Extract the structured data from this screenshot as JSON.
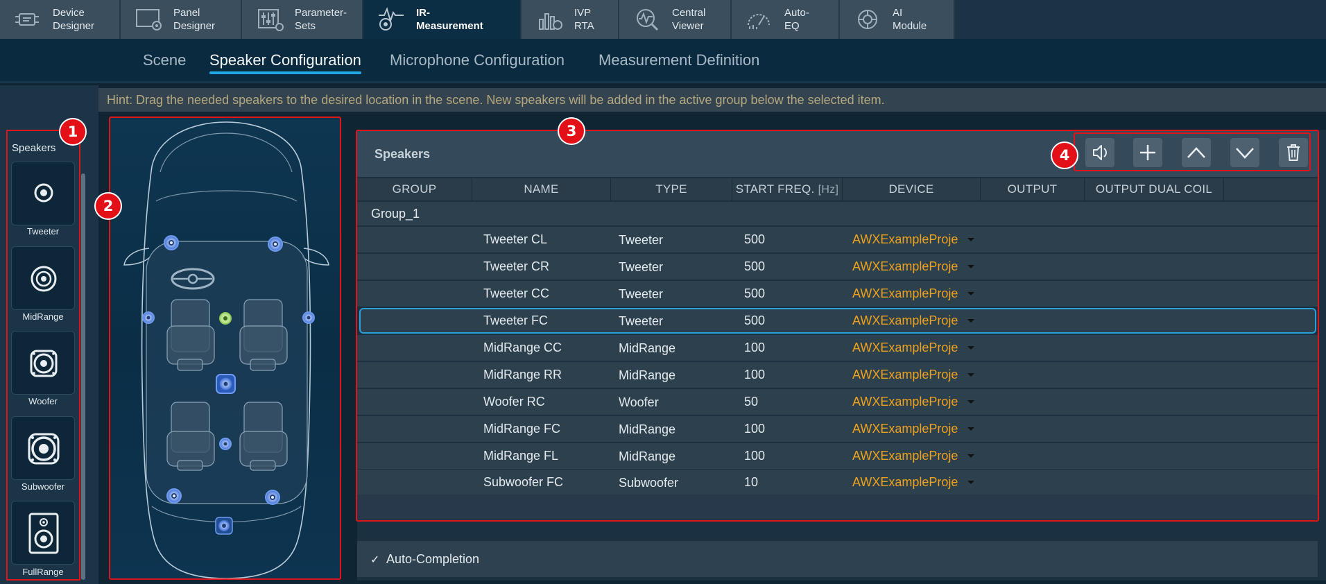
{
  "modules": [
    {
      "label": "Device\nDesigner",
      "icon": "device-designer-icon",
      "active": false
    },
    {
      "label": "Panel\nDesigner",
      "icon": "panel-designer-icon",
      "active": false
    },
    {
      "label": "Parameter-\nSets",
      "icon": "parameter-sets-icon",
      "active": false
    },
    {
      "label": "IR-\nMeasurement",
      "icon": "ir-measurement-icon",
      "active": true
    },
    {
      "label": "IVP\nRTA",
      "icon": "ivp-rta-icon",
      "active": false
    },
    {
      "label": "Central\nViewer",
      "icon": "central-viewer-icon",
      "active": false
    },
    {
      "label": "Auto-\nEQ",
      "icon": "auto-eq-icon",
      "active": false
    },
    {
      "label": "AI\nModule",
      "icon": "ai-module-icon",
      "active": false
    }
  ],
  "subtabs": [
    {
      "label": "Scene",
      "active": false
    },
    {
      "label": "Speaker Configuration",
      "active": true
    },
    {
      "label": "Microphone Configuration",
      "active": false
    },
    {
      "label": "Measurement Definition",
      "active": false
    }
  ],
  "hint": "Hint: Drag the needed speakers to the desired location in the scene. New speakers will be added in the active group below the selected item.",
  "palette": {
    "title": "Speakers",
    "items": [
      "Tweeter",
      "MidRange",
      "Woofer",
      "Subwoofer",
      "FullRange"
    ]
  },
  "badges": [
    "1",
    "2",
    "3",
    "4"
  ],
  "table": {
    "title": "Speakers",
    "toolbar_icons": [
      "speaker-test-icon",
      "add-icon",
      "move-up-icon",
      "move-down-icon",
      "delete-icon"
    ],
    "columns": {
      "group": "GROUP",
      "name": "NAME",
      "type": "TYPE",
      "start_freq": "START FREQ.",
      "start_freq_unit": "[Hz]",
      "device": "DEVICE",
      "output": "OUTPUT",
      "output_dual_coil": "OUTPUT DUAL COIL"
    },
    "group": "Group_1",
    "rows": [
      {
        "name": "Tweeter CL",
        "type": "Tweeter",
        "freq": "500",
        "device": "AWXExampleProje"
      },
      {
        "name": "Tweeter CR",
        "type": "Tweeter",
        "freq": "500",
        "device": "AWXExampleProje"
      },
      {
        "name": "Tweeter CC",
        "type": "Tweeter",
        "freq": "500",
        "device": "AWXExampleProje"
      },
      {
        "name": "Tweeter FC",
        "type": "Tweeter",
        "freq": "500",
        "device": "AWXExampleProje"
      },
      {
        "name": "MidRange CC",
        "type": "MidRange",
        "freq": "100",
        "device": "AWXExampleProje"
      },
      {
        "name": "MidRange RR",
        "type": "MidRange",
        "freq": "100",
        "device": "AWXExampleProje"
      },
      {
        "name": "Woofer RC",
        "type": "Woofer",
        "freq": "50",
        "device": "AWXExampleProje"
      },
      {
        "name": "MidRange FC",
        "type": "MidRange",
        "freq": "100",
        "device": "AWXExampleProje"
      },
      {
        "name": "MidRange FL",
        "type": "MidRange",
        "freq": "100",
        "device": "AWXExampleProje"
      },
      {
        "name": "Subwoofer FC",
        "type": "Subwoofer",
        "freq": "10",
        "device": "AWXExampleProje"
      }
    ],
    "selected_row": 3
  },
  "auto_completion": {
    "label": "Auto-Completion",
    "checked": true,
    "mark": "✓"
  },
  "colors": {
    "accent": "#23a8e6",
    "highlight": "#e0141b",
    "device_text": "#f0a21a",
    "selected_speaker": "#8ed05a"
  }
}
